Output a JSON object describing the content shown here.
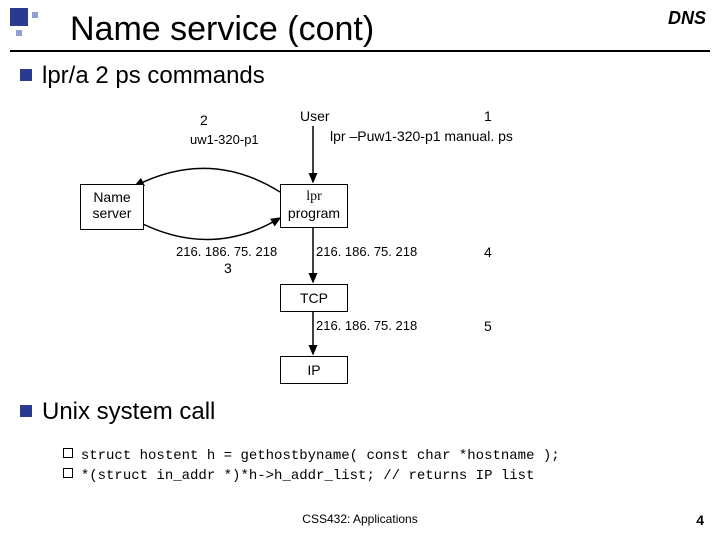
{
  "header": {
    "dns": "DNS",
    "title": "Name service (cont)"
  },
  "bullets": {
    "b1": "lpr/a 2 ps commands",
    "b2": "Unix system call"
  },
  "sub": {
    "s1": "struct hostent h = gethostbyname( const char *hostname );",
    "s2": "*(struct in_addr *)*h->h_addr_list; // returns IP list"
  },
  "diagram": {
    "user": "User",
    "step1": "1",
    "step2": "2",
    "hostname": "uw1-320-p1",
    "cmd": "lpr –Puw1-320-p1 manual. ps",
    "ns_label": "Name\nserver",
    "lpr_top": "lpr",
    "lpr_bottom": "program",
    "ip3": "216. 186. 75. 218",
    "step3": "3",
    "ip4": "216. 186. 75. 218",
    "step4": "4",
    "tcp": "TCP",
    "ip5": "216. 186. 75. 218",
    "step5": "5",
    "ip_label": "IP"
  },
  "footer": {
    "center": "CSS432: Applications",
    "page": "4"
  }
}
